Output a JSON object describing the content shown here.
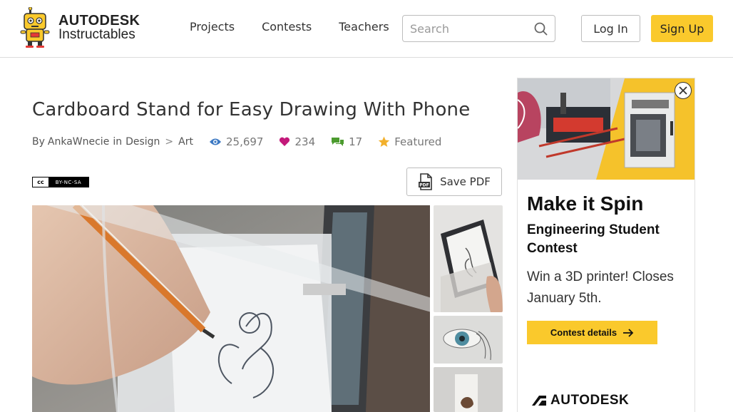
{
  "header": {
    "brand_line1": "AUTODESK",
    "brand_line2": "Instructables",
    "nav": [
      {
        "label": "Projects"
      },
      {
        "label": "Contests"
      },
      {
        "label": "Teachers"
      }
    ],
    "search_placeholder": "Search",
    "login_label": "Log In",
    "signup_label": "Sign Up"
  },
  "article": {
    "title": "Cardboard Stand for Easy Drawing With Phone",
    "by_label": "By",
    "author": "AnkaWnecie",
    "in_label": "in",
    "category": "Design",
    "separator": ">",
    "subcategory": "Art",
    "views": "25,697",
    "favorites": "234",
    "comments": "17",
    "featured_label": "Featured",
    "license_left": "cc",
    "license": "BY-NC-SA",
    "save_pdf_label": "Save PDF",
    "pdf_icon_text": "PDF"
  },
  "ad": {
    "headline": "Make it Spin",
    "subheadline": "Engineering Student Contest",
    "body": "Win a 3D printer! Closes January 5th.",
    "button_label": "Contest details",
    "brand": "AUTODESK"
  },
  "colors": {
    "accent_yellow": "#fac92c",
    "views_icon": "#3d79c3",
    "favorites_icon": "#c3197a",
    "comments_icon": "#4c9b2f",
    "featured_icon": "#f2b02c"
  }
}
